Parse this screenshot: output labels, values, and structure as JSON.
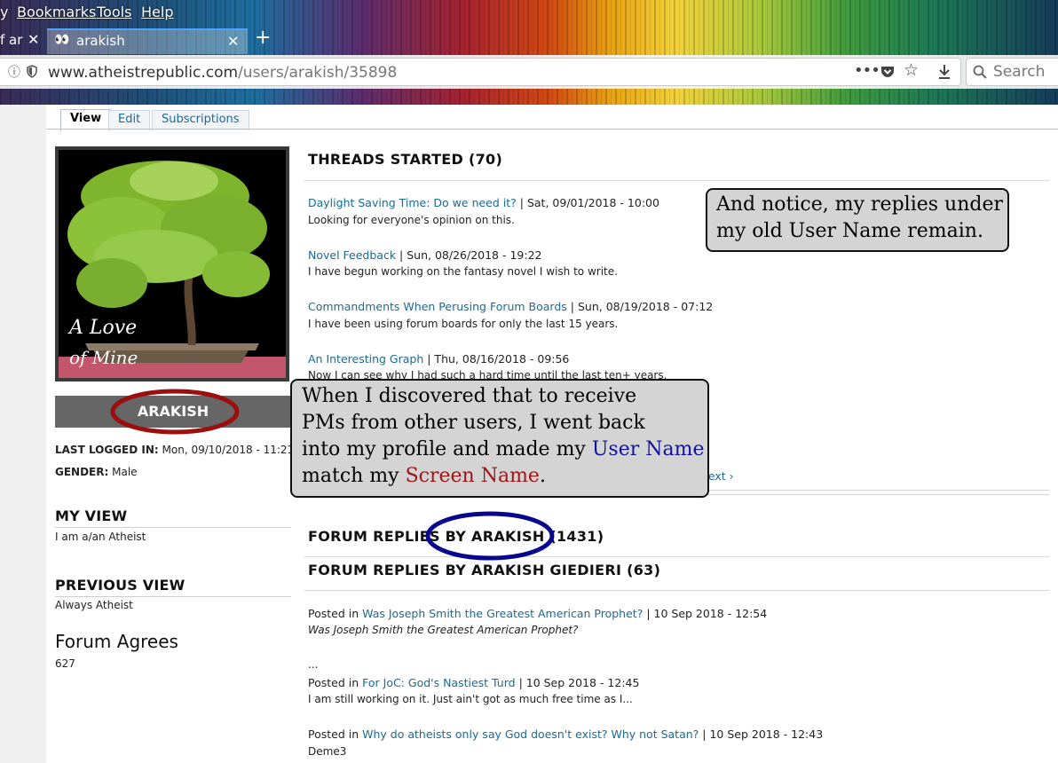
{
  "browser": {
    "menu": [
      "y",
      "Bookmarks",
      "Tools",
      "Help"
    ],
    "tabs": [
      {
        "label": "f ar"
      },
      {
        "label": "arakish"
      }
    ],
    "new_tab": "+",
    "url_host": "www.atheistrepublic.com",
    "url_path": "/users/arakish/35898",
    "search_placeholder": "Search",
    "toolbar_icons": [
      "info-icon",
      "shield-icon",
      "page-actions-icon",
      "pocket-icon",
      "bookmark-star-icon",
      "download-icon",
      "search-icon"
    ]
  },
  "profile_tabs": [
    "View",
    "Edit",
    "Subscriptions"
  ],
  "profile": {
    "avatar_caption_line1": "A Love",
    "avatar_caption_line2": "of Mine",
    "screen_name": "ARAKISH",
    "last_logged_label": "LAST LOGGED IN:",
    "last_logged_value": "Mon, 09/10/2018 - 11:21",
    "gender_label": "GENDER:",
    "gender_value": "Male",
    "my_view_heading": "MY VIEW",
    "my_view_value": "I am a/an Atheist",
    "previous_view_heading": "PREVIOUS VIEW",
    "previous_view_value": "Always Atheist",
    "forum_agrees_heading": "Forum Agrees",
    "forum_agrees_value": "627"
  },
  "threads": {
    "heading": "THREADS STARTED (70)",
    "items": [
      {
        "title": "Daylight Saving Time: Do we need it?",
        "date": "| Sat, 09/01/2018 - 10:00",
        "desc": "Looking for everyone's opinion on this."
      },
      {
        "title": "Novel Feedback",
        "date": "| Sun, 08/26/2018 - 19:22",
        "desc": "I have begun working on the fantasy novel I wish to write."
      },
      {
        "title": "Commandments When Perusing Forum Boards",
        "date": "| Sun, 08/19/2018 - 07:12",
        "desc": "I have been using forum boards for only the last 15 years."
      },
      {
        "title": "An Interesting Graph",
        "date": "| Thu, 08/16/2018 - 09:56",
        "desc": "Now I can see why I had such a hard time until the last ten+ years."
      }
    ],
    "pager_next": "next ›"
  },
  "replies_heading_1": "FORUM REPLIES BY ARAKISH (1431)",
  "replies_heading_2": "FORUM REPLIES BY ARAKISH GIEDIERI (63)",
  "replies": [
    {
      "prefix": "Posted in",
      "title": "Was Joseph Smith the Greatest American Prophet?",
      "date": "| 10 Sep 2018 - 12:54",
      "excerpt": "Was Joseph Smith the Greatest American Prophet?",
      "extra": "..."
    },
    {
      "prefix": "Posted in",
      "title": "For JoC: God's Nastiest Turd",
      "date": "| 10 Sep 2018 - 12:45",
      "excerpt": "I am still working on it. Just ain't got as much free time as I..."
    },
    {
      "prefix": "Posted in",
      "title": "Why do atheists only say God doesn't exist? Why not Satan?",
      "date": "| 10 Sep 2018 - 12:43",
      "excerpt": "Deme3"
    }
  ],
  "callouts": {
    "notice_line1": "And notice, my replies under",
    "notice_line2": "my old User Name remain.",
    "discover_line1": "When I discovered that to receive",
    "discover_line2": "PMs from other users, I went back",
    "discover_line3a": "into my profile and made my ",
    "discover_line3b": "User Name",
    "discover_line4a": "match my ",
    "discover_line4b": "Screen Name",
    "discover_line4c": "."
  },
  "colors": {
    "link": "#1b6a95",
    "red_ellipse": "#9b0f0f",
    "blue_ellipse": "#08088e",
    "user_name_text": "#13139a",
    "screen_name_text": "#a01616",
    "callout_bg": "#d4d4d4"
  }
}
